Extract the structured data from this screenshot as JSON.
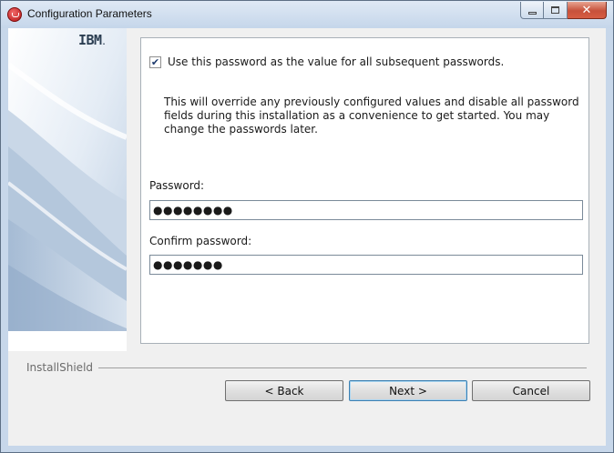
{
  "window": {
    "title": "Configuration Parameters",
    "icon": "ibm-installer-icon"
  },
  "banner": {
    "logo_text": "IBM",
    "logo_suffix": "."
  },
  "options": {
    "use_same_password_checked": true,
    "use_same_password_mark": "✔",
    "use_same_password_label": "Use this password as the value for all subsequent passwords."
  },
  "info": {
    "line1": "This will override any previously configured values and disable all password",
    "line2": "fields during this installation as a convenience to get started. You may",
    "line3": "change the passwords later."
  },
  "fields": {
    "password_label": "Password:",
    "password_value": "●●●●●●●●",
    "confirm_label": "Confirm password:",
    "confirm_value": "●●●●●●●"
  },
  "footer": {
    "brand": "InstallShield"
  },
  "buttons": {
    "back": "< Back",
    "next": "Next >",
    "cancel": "Cancel"
  },
  "colors": {
    "accent": "#3c7fb1",
    "close_button": "#c7513b"
  }
}
